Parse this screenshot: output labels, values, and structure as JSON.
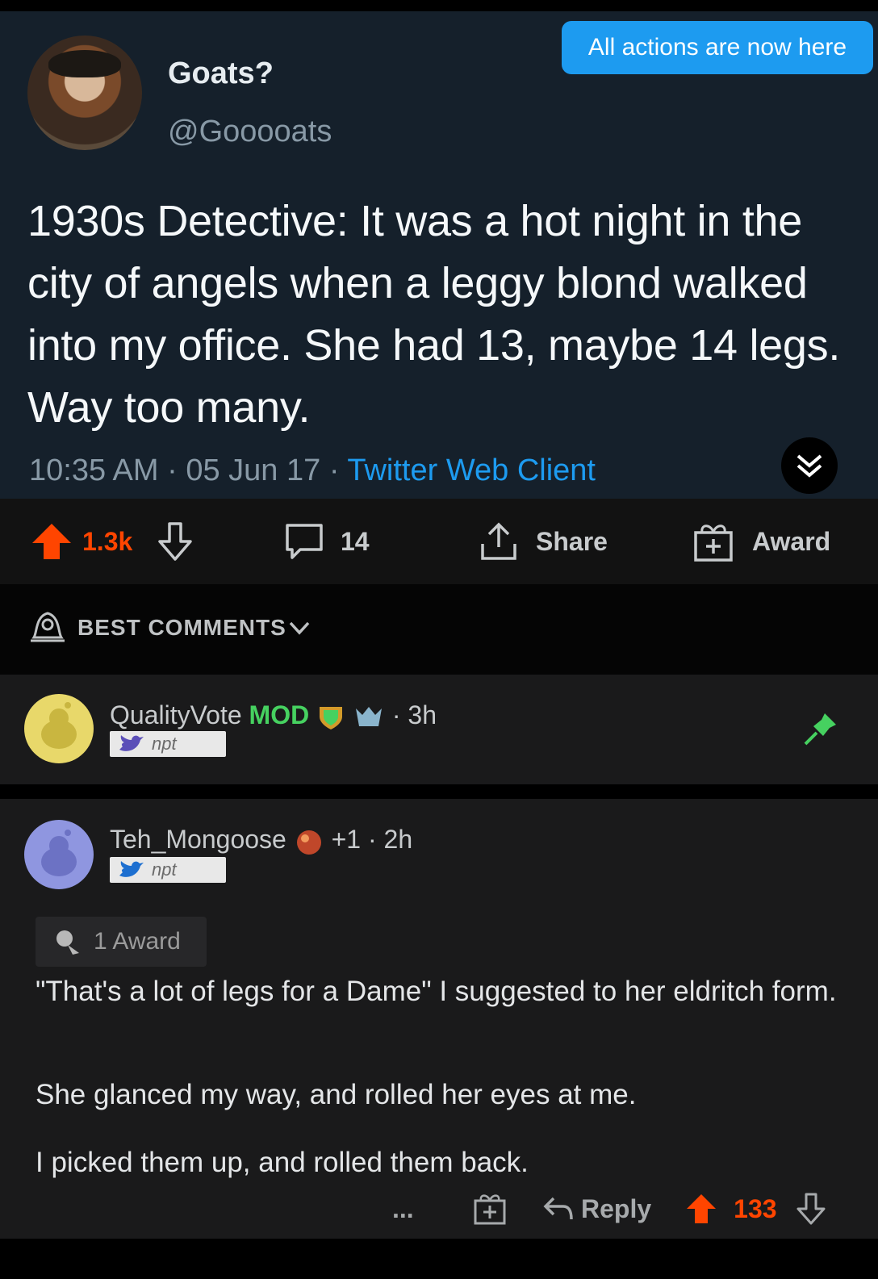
{
  "tweet": {
    "display_name": "Goats?",
    "handle": "@Gooooats",
    "text": "1930s Detective: It was a hot night in the city of angels when a leggy blond walked into my office. She had 13, maybe 14 legs. Way too many.",
    "time": "10:35 AM",
    "date": "05 Jun 17",
    "source": "Twitter Web Client"
  },
  "banner": {
    "label": "All actions are now here"
  },
  "post_actions": {
    "upvotes": "1.3k",
    "comments": "14",
    "share_label": "Share",
    "award_label": "Award"
  },
  "comments_sort": {
    "label": "BEST COMMENTS"
  },
  "comments": [
    {
      "username": "QualityVote",
      "mod_label": "MOD",
      "age": "3h",
      "flair": "npt",
      "pinned": true
    },
    {
      "username": "Teh_Mongoose",
      "karma_badge": "+1",
      "age": "2h",
      "flair": "npt",
      "award_label": "1 Award",
      "body": [
        "\"That's a lot of legs for a Dame\" I suggested to her eldritch form.",
        "She glanced my way, and rolled her eyes at me.",
        "I picked them up, and rolled them back."
      ],
      "more_label": "...",
      "reply_label": "Reply",
      "score": "133"
    }
  ],
  "colors": {
    "tweet_bg": "#15202b",
    "twitter_blue": "#1d9bf0",
    "upvote_orange": "#ff4500",
    "mod_green": "#46d160",
    "comment_bg": "#1a1a1b"
  },
  "icons": [
    "upvote-arrow-icon",
    "downvote-arrow-icon",
    "comment-bubble-icon",
    "share-icon",
    "award-gift-icon",
    "bell-icon",
    "pin-icon",
    "reply-arrow-icon",
    "chevron-down-icon",
    "double-chevron-icon",
    "twitter-bird-icon",
    "award-rose-icon"
  ]
}
